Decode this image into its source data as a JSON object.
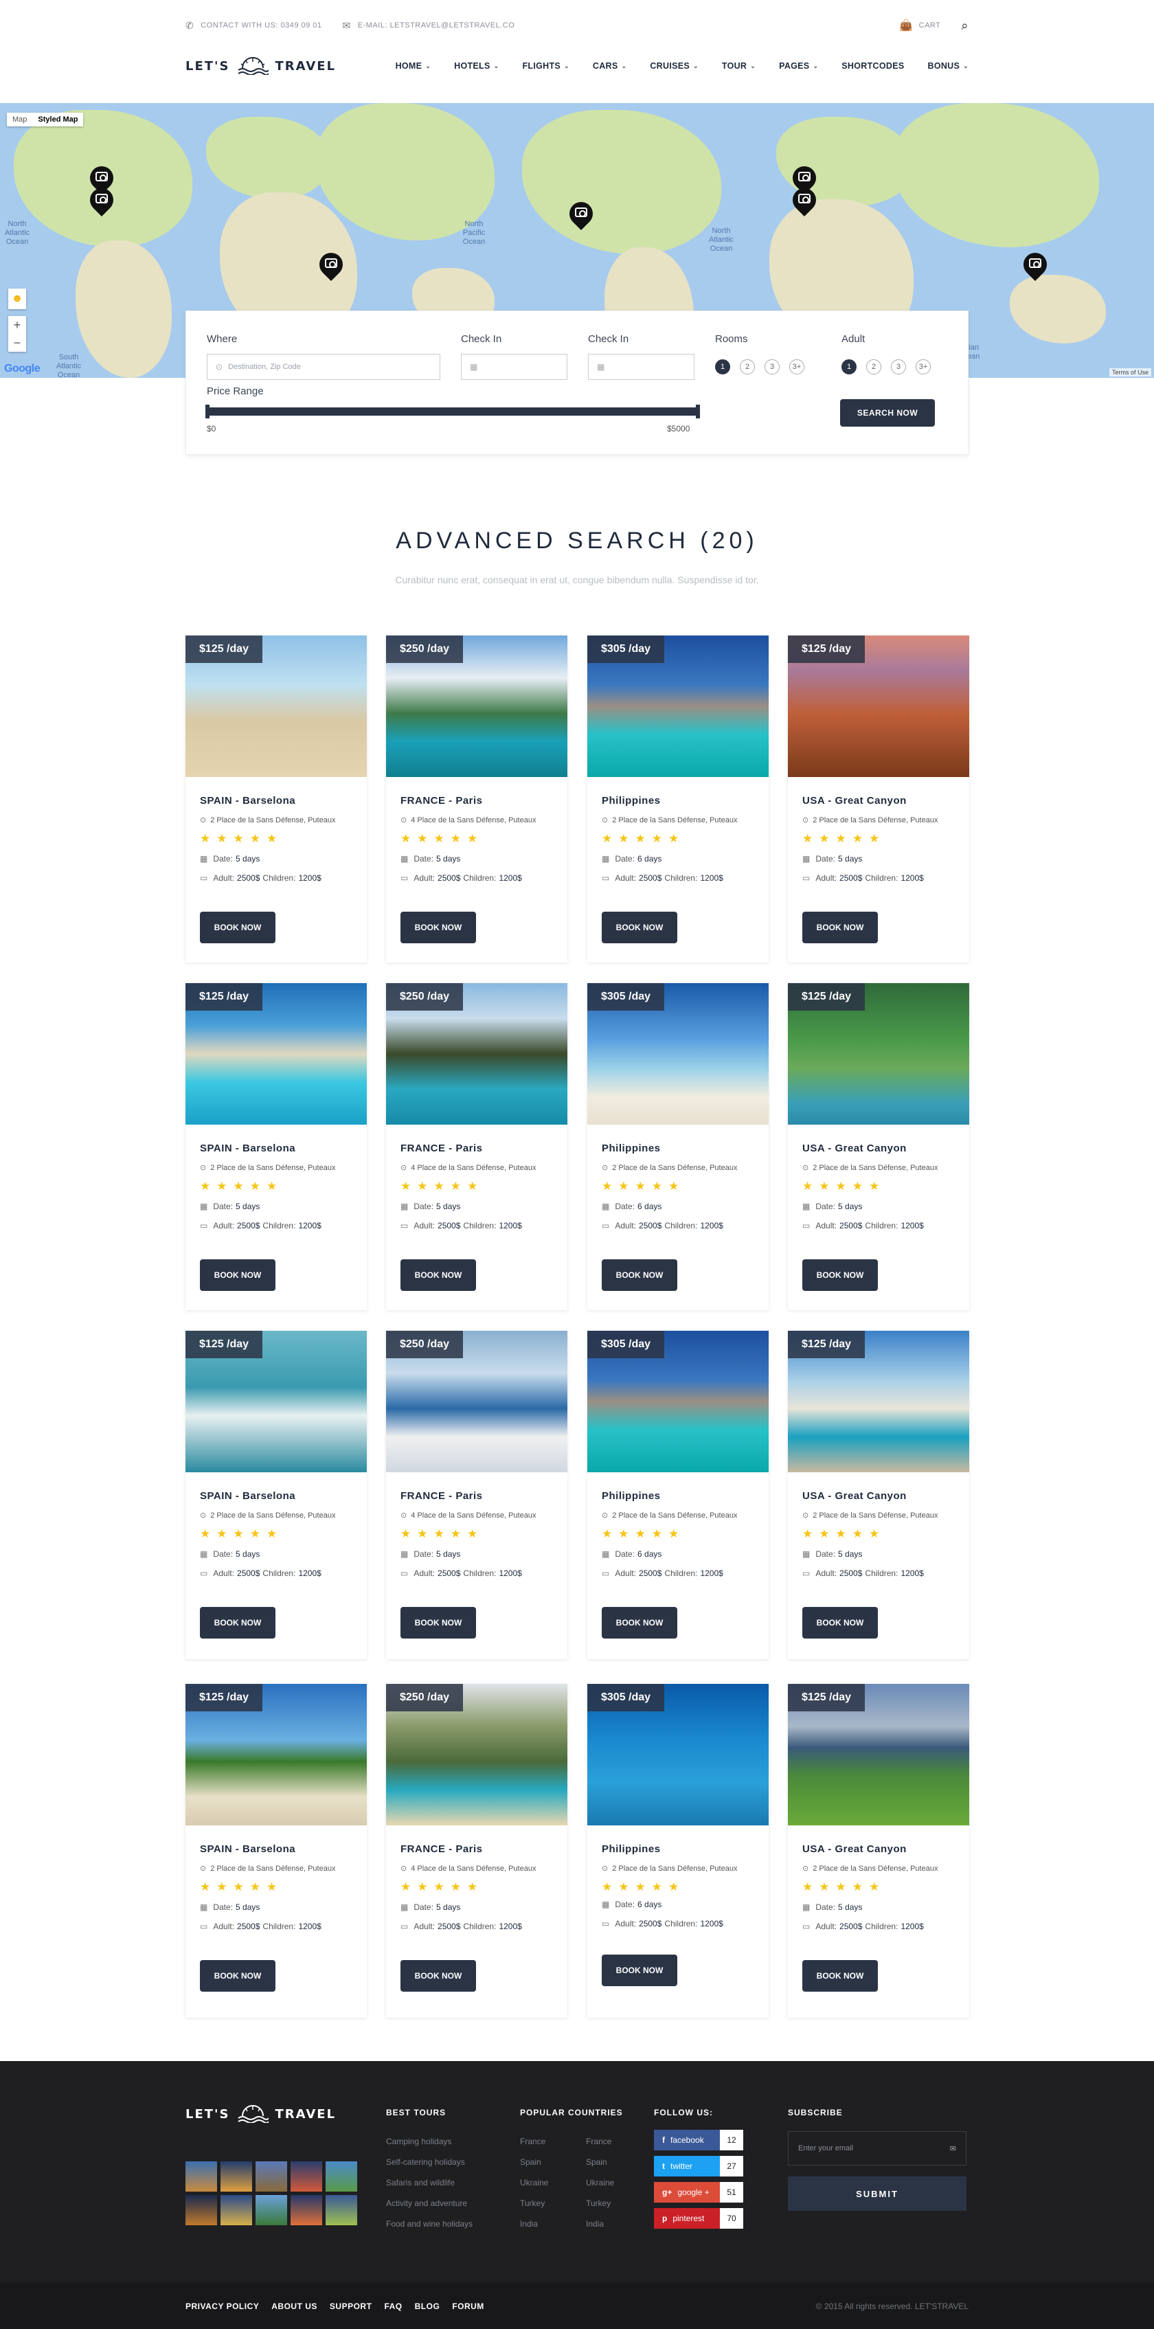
{
  "topbar": {
    "contact": "CONTACT WITH US: 0349 09 01",
    "email": "E-MAIL: LETSTRAVEL@LETSTRAVEL.CO",
    "cart": "CART"
  },
  "brand": {
    "left": "LET'S",
    "right": "TRAVEL"
  },
  "nav": {
    "items": [
      "HOME",
      "HOTELS",
      "FLIGHTS",
      "CARS",
      "CRUISES",
      "TOUR",
      "PAGES",
      "SHORTCODES",
      "BONUS"
    ]
  },
  "map": {
    "type_map": "Map",
    "type_styled": "Styled Map",
    "oceans": [
      "North Atlantic Ocean",
      "North Pacific Ocean",
      "North Atlantic Ocean",
      "South Atlantic Ocean",
      "Indian Ocean"
    ],
    "terms": "Terms of Use",
    "google": "Google"
  },
  "search": {
    "where_label": "Where",
    "where_placeholder": "Destination, Zip Code",
    "checkin_label": "Check In",
    "checkin2_label": "Check In",
    "rooms_label": "Rooms",
    "adult_label": "Adult",
    "rooms_options": [
      "1",
      "2",
      "3",
      "3+"
    ],
    "adult_options": [
      "1",
      "2",
      "3",
      "3+"
    ],
    "rooms_selected": "1",
    "adult_selected": "1",
    "price_label": "Price Range",
    "price_min": "$0",
    "price_max": "$5000",
    "button": "SEARCH NOW"
  },
  "section": {
    "title": "ADVANCED SEARCH (20)",
    "subtitle": "Curabitur nunc erat, consequat in erat ut, congue bibendum nulla. Suspendisse id tor."
  },
  "cards": [
    {
      "price": "$125 /day",
      "title": "SPAIN - Barselona",
      "address": "2 Place de la Sans Défense, Puteaux",
      "date_label": "Date:",
      "date": "5 days",
      "adult_label": "Adult:",
      "adult": "2500$",
      "children_label": "Children:",
      "children": "1200$",
      "button": "BOOK NOW"
    },
    {
      "price": "$250 /day",
      "title": "FRANCE - Paris",
      "address": "4 Place de la Sans Défense, Puteaux",
      "date_label": "Date:",
      "date": "5 days",
      "adult_label": "Adult:",
      "adult": "2500$",
      "children_label": "Children:",
      "children": "1200$",
      "button": "BOOK NOW"
    },
    {
      "price": "$305 /day",
      "title": "Philippines",
      "address": "2 Place de la Sans Défense, Puteaux",
      "date_label": "Date:",
      "date": "6 days",
      "adult_label": "Adult:",
      "adult": "2500$",
      "children_label": "Children:",
      "children": "1200$",
      "button": "BOOK NOW"
    },
    {
      "price": "$125 /day",
      "title": "USA - Great Canyon",
      "address": "2 Place de la Sans Défense, Puteaux",
      "date_label": "Date:",
      "date": "5 days",
      "adult_label": "Adult:",
      "adult": "2500$",
      "children_label": "Children:",
      "children": "1200$",
      "button": "BOOK NOW"
    },
    {
      "price": "$125 /day",
      "title": "SPAIN - Barselona",
      "address": "2 Place de la Sans Défense, Puteaux",
      "date_label": "Date:",
      "date": "5 days",
      "adult_label": "Adult:",
      "adult": "2500$",
      "children_label": "Children:",
      "children": "1200$",
      "button": "BOOK NOW"
    },
    {
      "price": "$250 /day",
      "title": "FRANCE - Paris",
      "address": "4 Place de la Sans Défense, Puteaux",
      "date_label": "Date:",
      "date": "5 days",
      "adult_label": "Adult:",
      "adult": "2500$",
      "children_label": "Children:",
      "children": "1200$",
      "button": "BOOK NOW"
    },
    {
      "price": "$305 /day",
      "title": "Philippines",
      "address": "2 Place de la Sans Défense, Puteaux",
      "date_label": "Date:",
      "date": "6 days",
      "adult_label": "Adult:",
      "adult": "2500$",
      "children_label": "Children:",
      "children": "1200$",
      "button": "BOOK NOW"
    },
    {
      "price": "$125 /day",
      "title": "USA - Great Canyon",
      "address": "2 Place de la Sans Défense, Puteaux",
      "date_label": "Date:",
      "date": "5 days",
      "adult_label": "Adult:",
      "adult": "2500$",
      "children_label": "Children:",
      "children": "1200$",
      "button": "BOOK NOW"
    },
    {
      "price": "$125 /day",
      "title": "SPAIN - Barselona",
      "address": "2 Place de la Sans Défense, Puteaux",
      "date_label": "Date:",
      "date": "5 days",
      "adult_label": "Adult:",
      "adult": "2500$",
      "children_label": "Children:",
      "children": "1200$",
      "button": "BOOK NOW"
    },
    {
      "price": "$250 /day",
      "title": "FRANCE - Paris",
      "address": "4 Place de la Sans Défense, Puteaux",
      "date_label": "Date:",
      "date": "5 days",
      "adult_label": "Adult:",
      "adult": "2500$",
      "children_label": "Children:",
      "children": "1200$",
      "button": "BOOK NOW"
    },
    {
      "price": "$305 /day",
      "title": "Philippines",
      "address": "2 Place de la Sans Défense, Puteaux",
      "date_label": "Date:",
      "date": "6 days",
      "adult_label": "Adult:",
      "adult": "2500$",
      "children_label": "Children:",
      "children": "1200$",
      "button": "BOOK NOW"
    },
    {
      "price": "$125 /day",
      "title": "USA - Great Canyon",
      "address": "2 Place de la Sans Défense, Puteaux",
      "date_label": "Date:",
      "date": "5 days",
      "adult_label": "Adult:",
      "adult": "2500$",
      "children_label": "Children:",
      "children": "1200$",
      "button": "BOOK NOW"
    },
    {
      "price": "$125 /day",
      "title": "SPAIN - Barselona",
      "address": "2 Place de la Sans Défense, Puteaux",
      "date_label": "Date:",
      "date": "5 days",
      "adult_label": "Adult:",
      "adult": "2500$",
      "children_label": "Children:",
      "children": "1200$",
      "button": "BOOK NOW"
    },
    {
      "price": "$250 /day",
      "title": "FRANCE - Paris",
      "address": "4 Place de la Sans Défense, Puteaux",
      "date_label": "Date:",
      "date": "5 days",
      "adult_label": "Adult:",
      "adult": "2500$",
      "children_label": "Children:",
      "children": "1200$",
      "button": "BOOK NOW"
    },
    {
      "price": "$305 /day",
      "title": "Philippines",
      "address": "2 Place de la Sans Défense, Puteaux",
      "date_label": "Date:",
      "date": "6 days",
      "adult_label": "Adult:",
      "adult": "2500$",
      "children_label": "Children:",
      "children": "1200$",
      "button": "BOOK NOW"
    },
    {
      "price": "$125 /day",
      "title": "USA - Great Canyon",
      "address": "2 Place de la Sans Défense, Puteaux",
      "date_label": "Date:",
      "date": "5 days",
      "adult_label": "Adult:",
      "adult": "2500$",
      "children_label": "Children:",
      "children": "1200$",
      "button": "BOOK NOW"
    }
  ],
  "footer": {
    "best_tours_title": "BEST TOURS",
    "best_tours": [
      "Camping holidays",
      "Self-catering holidays",
      "Safaris and wildlife",
      "Activity and adventure",
      "Food and wine holidays"
    ],
    "countries_title": "POPULAR COUNTRIES",
    "countries_a": [
      "France",
      "Spain",
      "Ukraine",
      "Turkey",
      "India"
    ],
    "countries_b": [
      "France",
      "Spain",
      "Ukraine",
      "Turkey",
      "India"
    ],
    "follow_title": "FOLLOW US:",
    "social": [
      {
        "name": "facebook",
        "count": "12",
        "color": "#3b5998",
        "glyph": "f"
      },
      {
        "name": "twitter",
        "count": "27",
        "color": "#1da1f2",
        "glyph": "t"
      },
      {
        "name": "google +",
        "count": "51",
        "color": "#dd4b39",
        "glyph": "g+"
      },
      {
        "name": "pinterest",
        "count": "70",
        "color": "#cb2027",
        "glyph": "p"
      }
    ],
    "subscribe_title": "SUBSCRIBE",
    "email_placeholder": "Enter your email",
    "submit": "SUBMIT",
    "bottom_links": [
      "PRIVACY POLICY",
      "ABOUT US",
      "SUPPORT",
      "FAQ",
      "BLOG",
      "FORUM"
    ],
    "copyright": "© 2015 All rights reserved. LET'STRAVEL"
  },
  "colors": {
    "primary": "#2b3445",
    "star": "#f5c518",
    "footer_bg": "#1f1f22"
  }
}
